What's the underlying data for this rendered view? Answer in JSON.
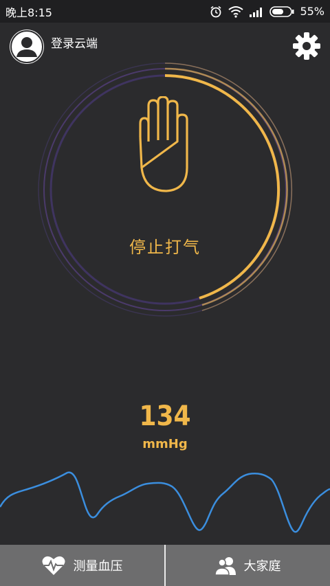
{
  "status_bar": {
    "time": "晚上8:15",
    "battery_percent": "55%",
    "icons": [
      "alarm-icon",
      "wifi-icon",
      "signal-icon",
      "battery-icon"
    ]
  },
  "header": {
    "login_label": "登录云端",
    "avatar_icon": "user-avatar-icon",
    "settings_icon": "gear-icon"
  },
  "dial": {
    "action_label": "停止打气",
    "icon": "hand-stop-icon",
    "accent_color": "#f0b74a",
    "track_color": "#4b3a6b"
  },
  "reading": {
    "value": "134",
    "unit": "mmHg"
  },
  "tabs": [
    {
      "label": "测量血压",
      "icon": "heart-pulse-icon"
    },
    {
      "label": "大家庭",
      "icon": "family-icon"
    }
  ]
}
